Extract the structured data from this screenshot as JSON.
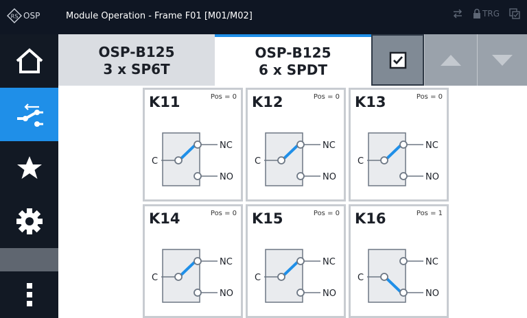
{
  "titlebar": {
    "app_label": "OSP",
    "title": "Module Operation - Frame F01 [M01/M02]",
    "trg_label": "TRG",
    "icons": [
      "rs-logo-icon",
      "swap-arrows-icon",
      "lock-icon",
      "window-check-icon"
    ]
  },
  "sidebar": {
    "items": [
      {
        "name": "home",
        "icon": "home-icon",
        "active": false
      },
      {
        "name": "module-operation",
        "icon": "switch-icon",
        "active": true
      },
      {
        "name": "favorites",
        "icon": "star-icon",
        "active": false
      },
      {
        "name": "settings",
        "icon": "gear-icon",
        "active": false
      },
      {
        "name": "more",
        "icon": "more-vertical-icon",
        "active": false
      }
    ]
  },
  "tabs": [
    {
      "line1": "OSP-B125",
      "line2": "3 x SP6T",
      "active": false
    },
    {
      "line1": "OSP-B125",
      "line2": "6 x SPDT",
      "active": true
    }
  ],
  "toolbar": {
    "icons": [
      "checkbox-icon",
      "arrow-up-icon",
      "arrow-down-icon"
    ]
  },
  "switches": [
    {
      "name": "K11",
      "pos_label": "Pos = 0",
      "pos": 0,
      "c": "C",
      "nc": "NC",
      "no": "NO"
    },
    {
      "name": "K12",
      "pos_label": "Pos = 0",
      "pos": 0,
      "c": "C",
      "nc": "NC",
      "no": "NO"
    },
    {
      "name": "K13",
      "pos_label": "Pos = 0",
      "pos": 0,
      "c": "C",
      "nc": "NC",
      "no": "NO"
    },
    {
      "name": "K14",
      "pos_label": "Pos = 0",
      "pos": 0,
      "c": "C",
      "nc": "NC",
      "no": "NO"
    },
    {
      "name": "K15",
      "pos_label": "Pos = 0",
      "pos": 0,
      "c": "C",
      "nc": "NC",
      "no": "NO"
    },
    {
      "name": "K16",
      "pos_label": "Pos = 1",
      "pos": 1,
      "c": "C",
      "nc": "NC",
      "no": "NO"
    }
  ],
  "colors": {
    "accent": "#1f8fe8",
    "switch_box": "#e9ebee",
    "switch_line": "#6d7784"
  }
}
